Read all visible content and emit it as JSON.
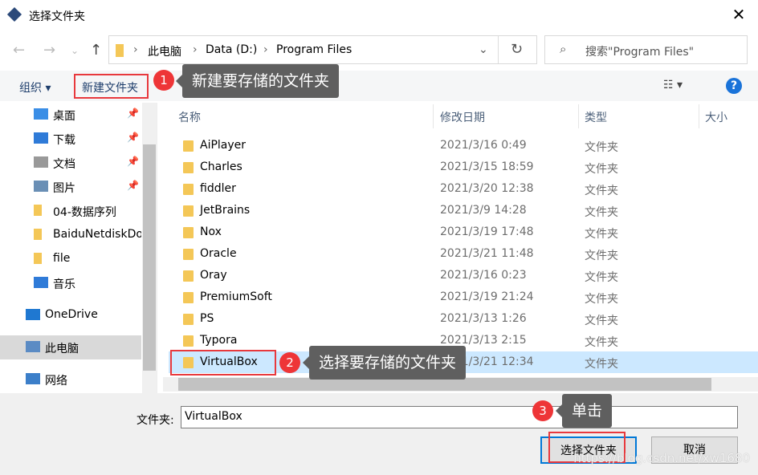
{
  "window": {
    "title": "选择文件夹",
    "close": "✕"
  },
  "nav": {
    "back": "←",
    "forward": "→",
    "recent": "⌄",
    "up": "↑",
    "refresh": "↻",
    "dropdown": "⌄",
    "breadcrumb": [
      "此电脑",
      "Data (D:)",
      "Program Files"
    ],
    "separator": "›",
    "search_placeholder": "搜索\"Program Files\""
  },
  "toolbar": {
    "organize": "组织 ▾",
    "new_folder": "新建文件夹",
    "view": "☷ ▾",
    "help": "?"
  },
  "sidebar": {
    "items": [
      {
        "label": "桌面",
        "icon": "desktop-icon",
        "pinned": true
      },
      {
        "label": "下载",
        "icon": "download-icon",
        "pinned": true
      },
      {
        "label": "文档",
        "icon": "document-icon",
        "pinned": true
      },
      {
        "label": "图片",
        "icon": "picture-icon",
        "pinned": true
      },
      {
        "label": "04-数据序列",
        "icon": "folder-icon"
      },
      {
        "label": "BaiduNetdiskDownload",
        "icon": "folder-icon"
      },
      {
        "label": "file",
        "icon": "folder-icon"
      },
      {
        "label": "音乐",
        "icon": "music-icon"
      },
      {
        "label": "OneDrive",
        "icon": "cloud-icon"
      },
      {
        "label": "此电脑",
        "icon": "computer-icon",
        "selected": true
      },
      {
        "label": "网络",
        "icon": "network-icon"
      }
    ]
  },
  "columns": {
    "name": "名称",
    "date": "修改日期",
    "type": "类型",
    "size": "大小"
  },
  "files": [
    {
      "name": "AiPlayer",
      "date": "2021/3/16 0:49",
      "type": "文件夹"
    },
    {
      "name": "Charles",
      "date": "2021/3/15 18:59",
      "type": "文件夹"
    },
    {
      "name": "fiddler",
      "date": "2021/3/20 12:38",
      "type": "文件夹"
    },
    {
      "name": "JetBrains",
      "date": "2021/3/9 14:28",
      "type": "文件夹"
    },
    {
      "name": "Nox",
      "date": "2021/3/19 17:48",
      "type": "文件夹"
    },
    {
      "name": "Oracle",
      "date": "2021/3/21 11:48",
      "type": "文件夹"
    },
    {
      "name": "Oray",
      "date": "2021/3/16 0:23",
      "type": "文件夹"
    },
    {
      "name": "PremiumSoft",
      "date": "2021/3/19 21:24",
      "type": "文件夹"
    },
    {
      "name": "PS",
      "date": "2021/3/13 1:26",
      "type": "文件夹"
    },
    {
      "name": "Typora",
      "date": "2021/3/13 2:15",
      "type": "文件夹"
    },
    {
      "name": "VirtualBox",
      "date": "2021/3/21 12:34",
      "type": "文件夹",
      "selected": true
    }
  ],
  "footer": {
    "folder_label": "文件夹:",
    "folder_value": "VirtualBox",
    "select": "选择文件夹",
    "cancel": "取消"
  },
  "annotations": [
    {
      "n": "1",
      "text": "新建要存储的文件夹"
    },
    {
      "n": "2",
      "text": "选择要存储的文件夹"
    },
    {
      "n": "3",
      "text": "单击"
    }
  ],
  "watermark": "https://blog.csdn.net/xw1680",
  "colors": {
    "selection": "#cce8ff",
    "annotation_red": "#e8393d",
    "tooltip": "#5f5f5f",
    "default_button_border": "#0078d7"
  }
}
